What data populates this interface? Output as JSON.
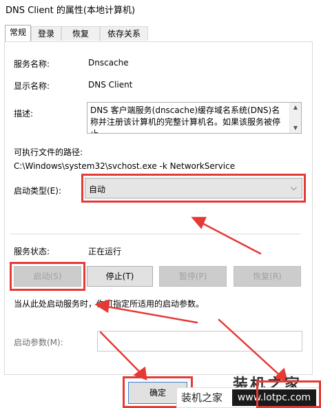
{
  "window": {
    "title": "DNS Client 的属性(本地计算机)"
  },
  "tabs": [
    {
      "label": "常规",
      "active": true
    },
    {
      "label": "登录",
      "active": false
    },
    {
      "label": "恢复",
      "active": false
    },
    {
      "label": "依存关系",
      "active": false
    }
  ],
  "general": {
    "service_name_label": "服务名称:",
    "service_name_value": "Dnscache",
    "display_name_label": "显示名称:",
    "display_name_value": "DNS Client",
    "description_label": "描述:",
    "description_text": "DNS 客户端服务(dnscache)缓存域名系统(DNS)名称并注册该计算机的完整计算机名。如果该服务被停止，",
    "path_label": "可执行文件的路径:",
    "path_value": "C:\\Windows\\system32\\svchost.exe -k NetworkService",
    "startup_type_label": "启动类型(E):",
    "startup_type_value": "自动",
    "status_label": "服务状态:",
    "status_value": "正在运行",
    "hint_text": "当从此处启动服务时，你可指定所适用的启动参数。",
    "start_params_label": "启动参数(M):"
  },
  "buttons": {
    "start": "启动(S)",
    "stop": "停止(T)",
    "pause": "暂停(P)",
    "resume": "恢复(R)",
    "ok": "确定"
  },
  "watermark": {
    "big": "装机之家",
    "small": "装机之家",
    "site": "www.lotpc.com"
  },
  "colors": {
    "annotation": "#e53935",
    "accent": "#3c7fd0"
  }
}
